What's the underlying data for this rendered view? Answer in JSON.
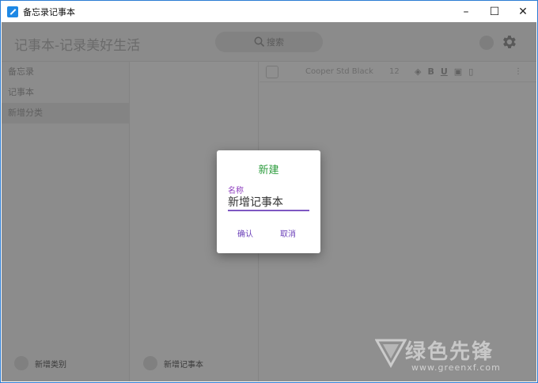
{
  "window": {
    "title": "备忘录记事本",
    "minimize_glyph": "–",
    "maximize_glyph": "☐",
    "close_glyph": "✕"
  },
  "header": {
    "title": "记事本-记录美好生活",
    "search_label": "搜索"
  },
  "categories": {
    "items": [
      {
        "label": "备忘录"
      },
      {
        "label": "记事本"
      },
      {
        "label": "新增分类"
      }
    ],
    "add_label": "新增类别"
  },
  "notes": {
    "add_label": "新增记事本"
  },
  "toolbar": {
    "font_name": "Cooper Std Black",
    "font_size": "12",
    "bold": "B",
    "underline": "U",
    "more": "⋮"
  },
  "dialog": {
    "title": "新建",
    "field_label": "名称",
    "field_value": "新增记事本",
    "confirm_label": "确认",
    "cancel_label": "取消"
  },
  "watermark": {
    "text": "绿色先锋",
    "url": "www.greenxf.com"
  },
  "colors": {
    "dialog_title": "#2e9d3f",
    "accent_purple": "#7e57c2",
    "window_border": "#2b7cd3"
  }
}
